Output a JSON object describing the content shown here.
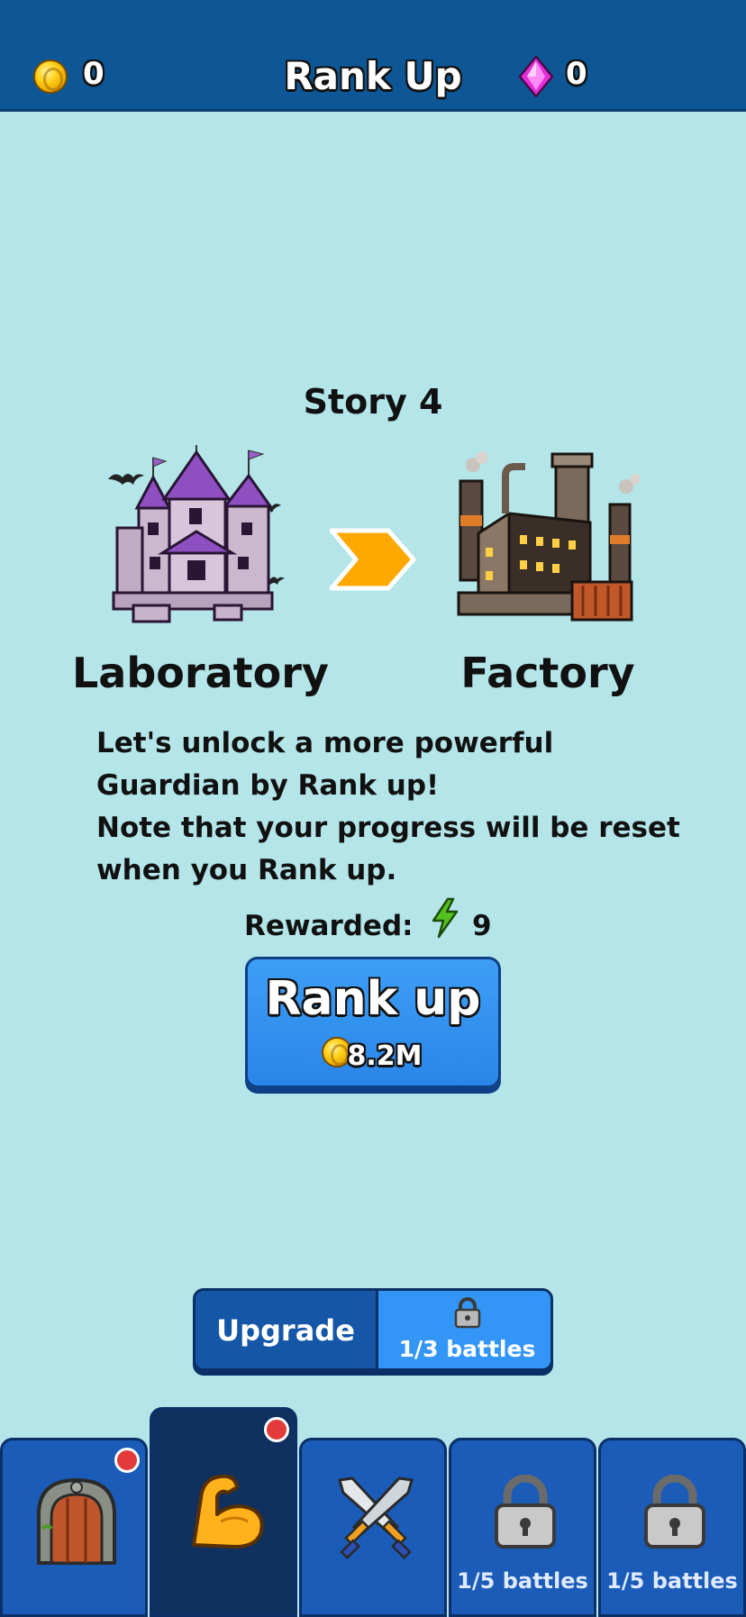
{
  "header": {
    "coins": "0",
    "title": "Rank Up",
    "gems": "0"
  },
  "story": {
    "title": "Story 4",
    "from_place": "Laboratory",
    "to_place": "Factory"
  },
  "description": {
    "lines": [
      "Let's unlock a more powerful",
      "Guardian by Rank up!",
      "Note that your progress will be reset",
      "when you Rank up."
    ]
  },
  "reward": {
    "label": "Rewarded:",
    "value": "9",
    "icon": "lightning-bolt-icon"
  },
  "rank_button": {
    "label": "Rank up",
    "cost": "8.2M"
  },
  "segment": {
    "upgrade_label": "Upgrade",
    "locked_label": "1/3 battles"
  },
  "nav": {
    "tabs": [
      {
        "icon": "dungeon-door-icon",
        "badge": true,
        "label": ""
      },
      {
        "icon": "flexed-arm-icon",
        "badge": true,
        "label": "",
        "active": true
      },
      {
        "icon": "crossed-swords-icon",
        "badge": false,
        "label": ""
      },
      {
        "icon": "lock-icon",
        "badge": false,
        "label": "1/5 battles"
      },
      {
        "icon": "lock-icon",
        "badge": false,
        "label": "1/5 battles"
      }
    ]
  },
  "colors": {
    "background": "#b3e5e9",
    "header": "#0e5796",
    "button": "#2a86e8",
    "arrow": "#ffa800",
    "badge": "#e33a3a"
  }
}
